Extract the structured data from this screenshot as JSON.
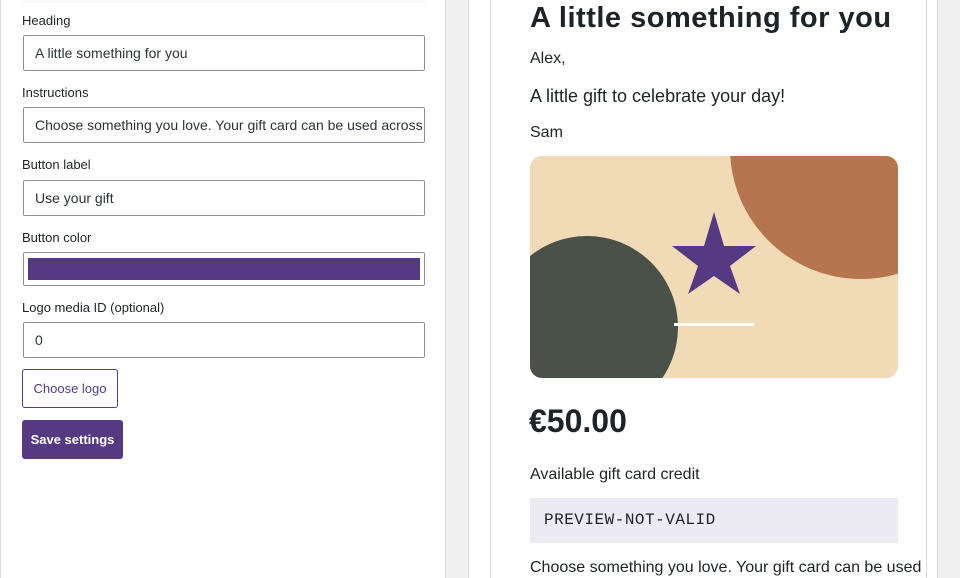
{
  "settings": {
    "heading_label": "Heading",
    "heading_value": "A little something for you",
    "instructions_label": "Instructions",
    "instructions_value": "Choose something you love. Your gift card can be used across our",
    "button_label_label": "Button label",
    "button_label_value": "Use your gift",
    "button_color_label": "Button color",
    "button_color_value": "#553a83",
    "logo_label": "Logo media ID (optional)",
    "logo_value": "0",
    "choose_logo": "Choose logo",
    "save_settings": "Save settings"
  },
  "preview": {
    "heading": "A little something for you",
    "recipient": "Alex,",
    "message": "A little gift to celebrate your day!",
    "sender": "Sam",
    "amount": "€50.00",
    "credit_label": "Available gift card credit",
    "code": "PREVIEW-NOT-VALID",
    "instructions": "Choose something you love. Your gift card can be used",
    "art_icon": "star-icon",
    "art_colors": {
      "background": "#f1dbb6",
      "circle_right": "#b5764f",
      "circle_left": "#4a5148",
      "star": "#553a83",
      "line": "#ffffff"
    }
  }
}
